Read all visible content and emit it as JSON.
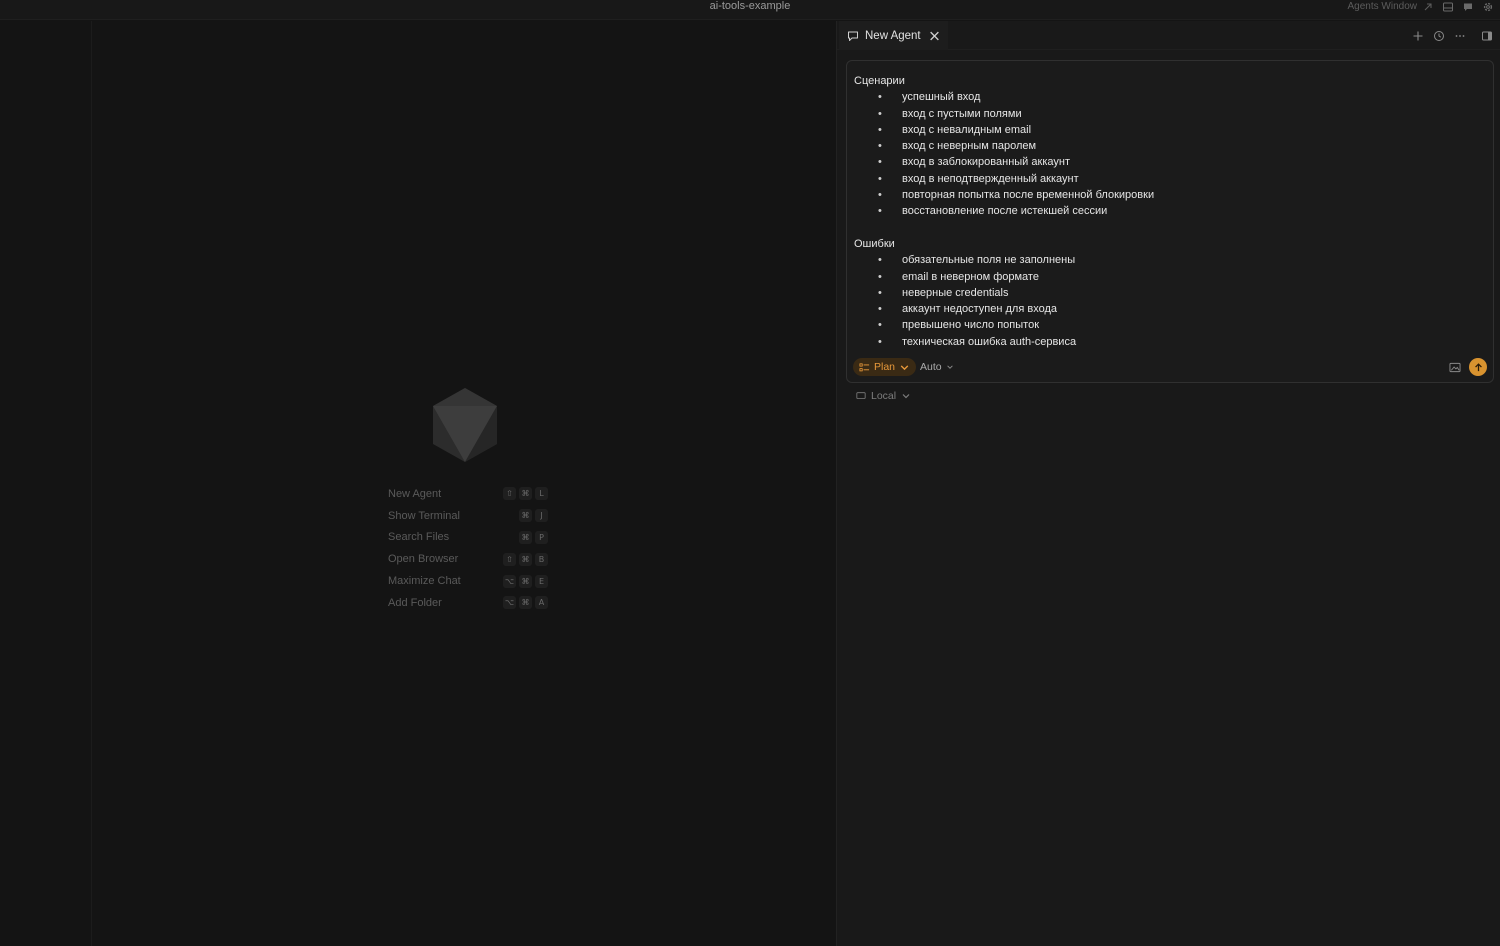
{
  "window": {
    "title": "ai-tools-example",
    "agents_window_label": "Agents Window"
  },
  "shortcuts": [
    {
      "label": "New Agent",
      "keys": [
        "⇧",
        "⌘",
        "L"
      ]
    },
    {
      "label": "Show Terminal",
      "keys": [
        "⌘",
        "J"
      ]
    },
    {
      "label": "Search Files",
      "keys": [
        "⌘",
        "P"
      ]
    },
    {
      "label": "Open Browser",
      "keys": [
        "⇧",
        "⌘",
        "B"
      ]
    },
    {
      "label": "Maximize Chat",
      "keys": [
        "⌥",
        "⌘",
        "E"
      ]
    },
    {
      "label": "Add Folder",
      "keys": [
        "⌥",
        "⌘",
        "A"
      ]
    }
  ],
  "panel": {
    "tab_label": "New Agent",
    "prompt": {
      "section1_title": "Сценарии",
      "section1_items": [
        "успешный вход",
        "вход с пустыми полями",
        "вход с невалидным email",
        "вход с неверным паролем",
        "вход в заблокированный аккаунт",
        "вход в неподтвержденный аккаунт",
        "повторная попытка после временной блокировки",
        "восстановление после истекшей сессии"
      ],
      "section2_title": "Ошибки",
      "section2_items": [
        "обязательные поля не заполнены",
        "email в неверном формате",
        "неверные credentials",
        "аккаунт недоступен для входа",
        "превышено число попыток",
        "техническая ошибка auth-сервиса"
      ]
    },
    "mode_label": "Plan",
    "model_label": "Auto",
    "environment_label": "Local"
  },
  "colors": {
    "accent": "#d9932f",
    "mode_text": "#e8993a"
  }
}
